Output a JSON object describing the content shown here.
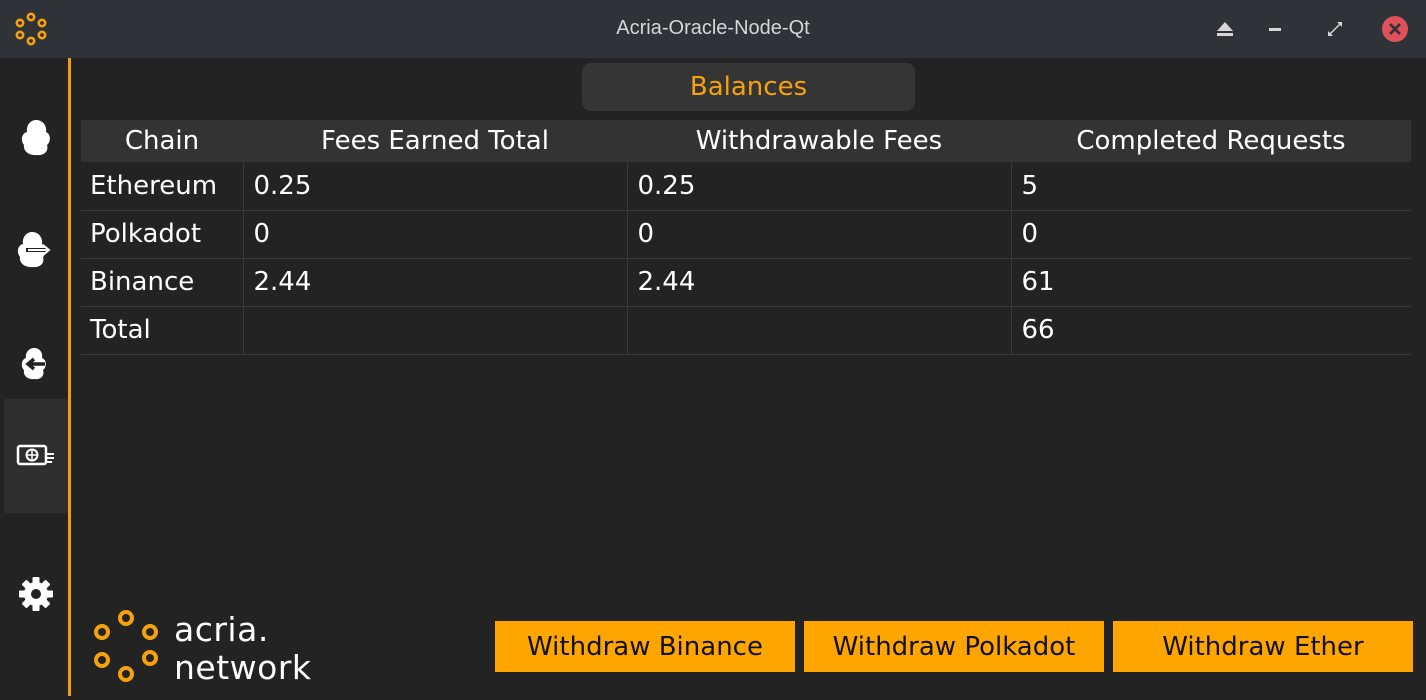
{
  "window": {
    "title": "Acria-Oracle-Node-Qt",
    "buttons": [
      "eject-icon",
      "minimize-icon",
      "maximize-icon",
      "close-icon"
    ]
  },
  "sidebar": {
    "items": [
      {
        "name": "cloud",
        "icon": "cloud-icon"
      },
      {
        "name": "outgoing",
        "icon": "cloud-arrow-out-icon"
      },
      {
        "name": "incoming",
        "icon": "cloud-arrow-in-icon"
      },
      {
        "name": "balances",
        "icon": "money-icon",
        "active": true
      },
      {
        "name": "settings",
        "icon": "gear-icon"
      }
    ],
    "accent_color": "#f39c12"
  },
  "tab": {
    "label": "Balances"
  },
  "table": {
    "headers": [
      "Chain",
      "Fees Earned Total",
      "Withdrawable Fees",
      "Completed Requests"
    ],
    "rows": [
      [
        "Ethereum",
        "0.25",
        "0.25",
        "5"
      ],
      [
        "Polkadot",
        "0",
        "0",
        "0"
      ],
      [
        "Binance",
        "2.44",
        "2.44",
        "61"
      ],
      [
        "Total",
        "",
        "",
        "66"
      ]
    ]
  },
  "logo": {
    "line1": "acria.",
    "line2": "network"
  },
  "actions": {
    "withdraw_binance": "Withdraw Binance",
    "withdraw_polkadot": "Withdraw Polkadot",
    "withdraw_ether": "Withdraw Ether"
  },
  "colors": {
    "accent": "#ffa500",
    "tab_text": "#f5a20e",
    "background": "#232323",
    "titlebar": "#2f3237",
    "close": "#e0525b"
  }
}
